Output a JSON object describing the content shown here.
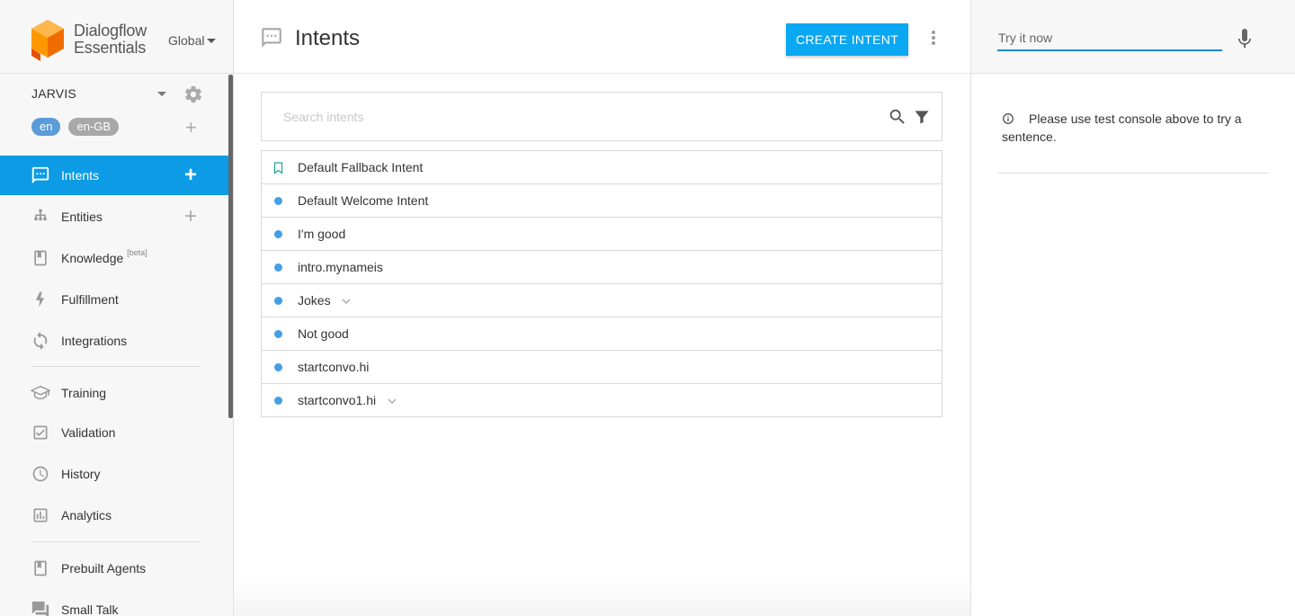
{
  "brand": {
    "line1": "Dialogflow",
    "line2": "Essentials",
    "region": "Global"
  },
  "agent": {
    "name": "JARVIS",
    "languages": [
      "en",
      "en-GB"
    ]
  },
  "sidebar": {
    "items": [
      {
        "label": "Intents",
        "icon": "chat-icon",
        "active": true,
        "has_add": true
      },
      {
        "label": "Entities",
        "icon": "hierarchy-icon",
        "active": false,
        "has_add": true
      },
      {
        "label": "Knowledge",
        "badge": "[beta]",
        "icon": "book-icon",
        "active": false
      },
      {
        "label": "Fulfillment",
        "icon": "bolt-icon",
        "active": false
      },
      {
        "label": "Integrations",
        "icon": "sync-icon",
        "active": false
      },
      {
        "label": "Training",
        "icon": "graduation-cap-icon",
        "active": false
      },
      {
        "label": "Validation",
        "icon": "check-box-icon",
        "active": false
      },
      {
        "label": "History",
        "icon": "clock-icon",
        "active": false
      },
      {
        "label": "Analytics",
        "icon": "bar-chart-icon",
        "active": false
      },
      {
        "label": "Prebuilt Agents",
        "icon": "bookmark-icon",
        "active": false
      },
      {
        "label": "Small Talk",
        "icon": "chat-bubbles-icon",
        "active": false
      }
    ]
  },
  "main": {
    "title": "Intents",
    "create_button": "CREATE INTENT",
    "search_placeholder": "Search intents",
    "intents": [
      {
        "name": "Default Fallback Intent",
        "marker": "bookmark",
        "expandable": false
      },
      {
        "name": "Default Welcome Intent",
        "marker": "dot",
        "expandable": false
      },
      {
        "name": "I'm good",
        "marker": "dot",
        "expandable": false
      },
      {
        "name": "intro.mynameis",
        "marker": "dot",
        "expandable": false
      },
      {
        "name": "Jokes",
        "marker": "dot",
        "expandable": true
      },
      {
        "name": "Not good",
        "marker": "dot",
        "expandable": false
      },
      {
        "name": "startconvo.hi",
        "marker": "dot",
        "expandable": false
      },
      {
        "name": "startconvo1.hi",
        "marker": "dot",
        "expandable": true
      }
    ]
  },
  "console": {
    "placeholder": "Try it now",
    "info": "Please use test console above to try a sentence."
  },
  "colors": {
    "accent": "#0c9be4",
    "create_button": "#0aa7f2",
    "intent_dot": "#449fe6",
    "bookmark": "#26a69a",
    "logo_orange": "#f57c00"
  }
}
